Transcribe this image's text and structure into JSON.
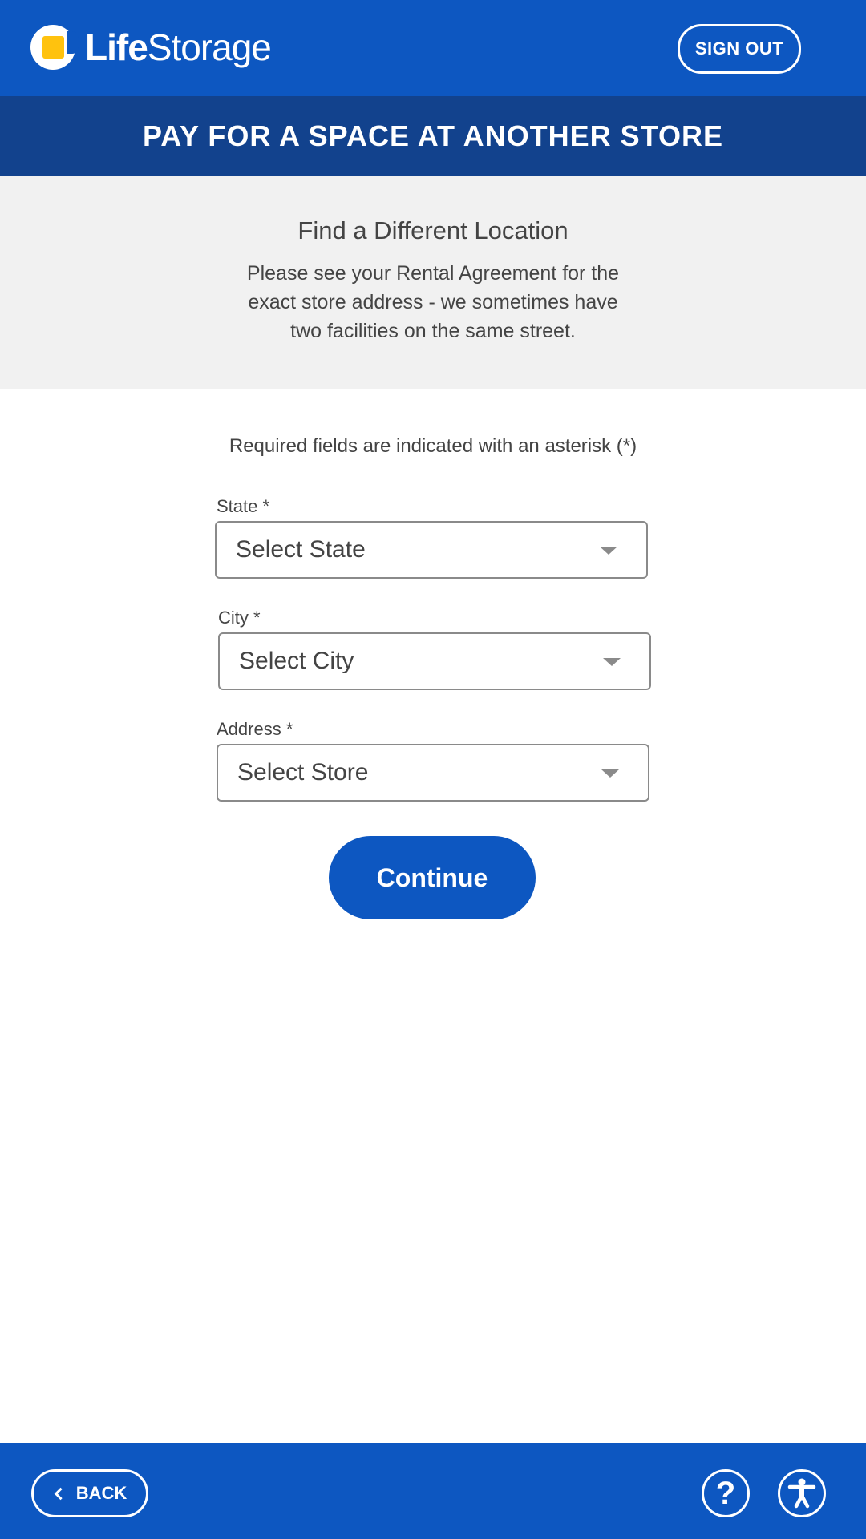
{
  "header": {
    "brand_light": "Life",
    "brand_rest": "Storage",
    "sign_out_label": "SIGN OUT"
  },
  "banner": {
    "title": "PAY FOR A SPACE AT ANOTHER STORE"
  },
  "info": {
    "heading": "Find a Different Location",
    "text": "Please see your Rental Agreement for the exact store address - we sometimes have two facilities on the same street."
  },
  "form": {
    "required_note": "Required fields are indicated with an asterisk (*)",
    "state": {
      "label": "State *",
      "value": "Select State"
    },
    "city": {
      "label": "City *",
      "value": "Select City"
    },
    "address": {
      "label": "Address *",
      "value": "Select Store"
    },
    "continue_label": "Continue"
  },
  "footer": {
    "back_label": "BACK",
    "help_glyph": "?"
  },
  "colors": {
    "brand_blue": "#0d57c1",
    "banner_blue": "#12428d",
    "logo_yellow": "#ffc20e",
    "panel_gray": "#f1f1f1"
  },
  "icons": [
    "logo-mark-icon",
    "chevron-down-icon",
    "chevron-left-icon",
    "help-icon",
    "accessibility-icon"
  ]
}
